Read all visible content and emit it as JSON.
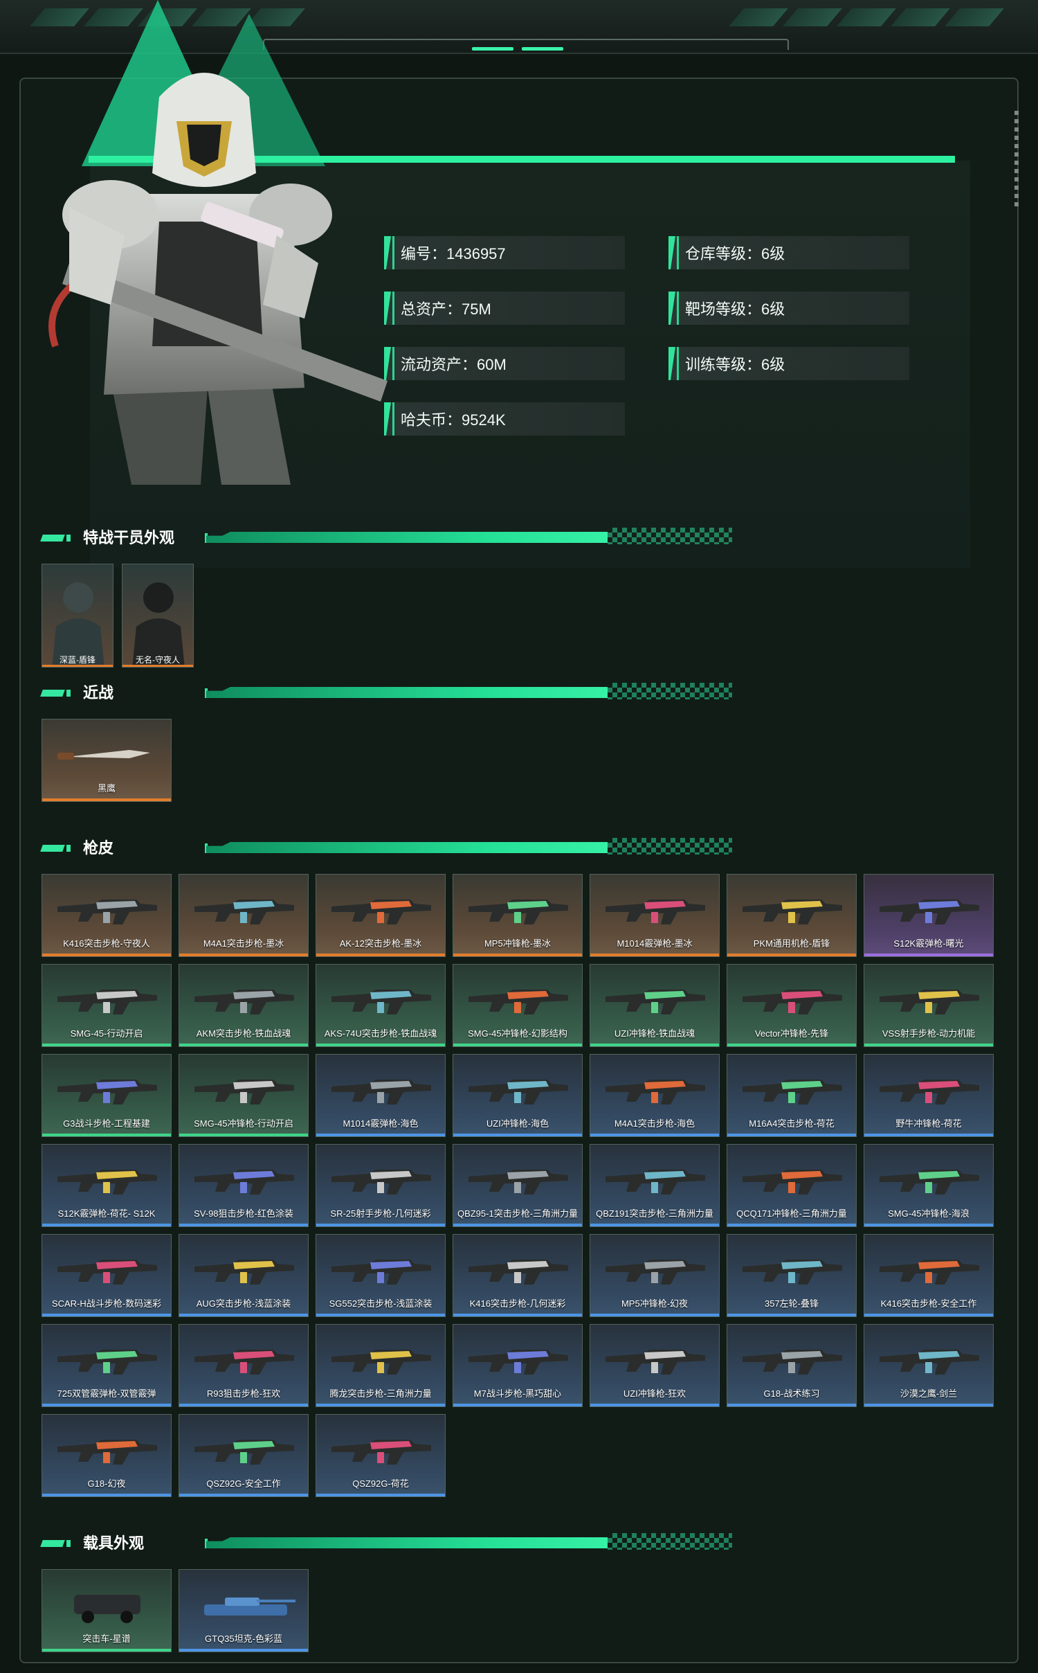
{
  "profile": {
    "id_label": "编号：1436957",
    "total_assets": "总资产：75M",
    "liquid_assets": "流动资产：60M",
    "havoc_coin": "哈夫币：9524K",
    "warehouse_level": "仓库等级：6级",
    "range_level": "靶场等级：6级",
    "training_level": "训练等级：6级"
  },
  "sections": {
    "operators": "特战干员外观",
    "melee": "近战",
    "skins": "枪皮",
    "vehicles": "载具外观"
  },
  "operators": [
    "深蓝-盾锋",
    "无名-守夜人"
  ],
  "melee": [
    "黑鹰"
  ],
  "skins": [
    {
      "label": "K416突击步枪-守夜人",
      "rarity": "orange"
    },
    {
      "label": "M4A1突击步枪-墨冰",
      "rarity": "orange"
    },
    {
      "label": "AK-12突击步枪-墨冰",
      "rarity": "orange"
    },
    {
      "label": "MP5冲锋枪-墨冰",
      "rarity": "orange"
    },
    {
      "label": "M1014霰弹枪-墨冰",
      "rarity": "orange"
    },
    {
      "label": "PKM通用机枪-盾锋",
      "rarity": "orange"
    },
    {
      "label": "S12K霰弹枪-曙光",
      "rarity": "purple"
    },
    {
      "label": "SMG-45-行动开启",
      "rarity": "green"
    },
    {
      "label": "AKM突击步枪-铁血战魂",
      "rarity": "green"
    },
    {
      "label": "AKS-74U突击步枪-铁血战魂",
      "rarity": "green"
    },
    {
      "label": "SMG-45冲锋枪-幻影结构",
      "rarity": "green"
    },
    {
      "label": "UZI冲锋枪-铁血战魂",
      "rarity": "green"
    },
    {
      "label": "Vector冲锋枪-先锋",
      "rarity": "green"
    },
    {
      "label": "VSS射手步枪-动力机能",
      "rarity": "green"
    },
    {
      "label": "G3战斗步枪-工程基建",
      "rarity": "green"
    },
    {
      "label": "SMG-45冲锋枪-行动开启",
      "rarity": "green"
    },
    {
      "label": "M1014霰弹枪-海色",
      "rarity": "blue"
    },
    {
      "label": "UZI冲锋枪-海色",
      "rarity": "blue"
    },
    {
      "label": "M4A1突击步枪-海色",
      "rarity": "blue"
    },
    {
      "label": "M16A4突击步枪-荷花",
      "rarity": "blue"
    },
    {
      "label": "野牛冲锋枪-荷花",
      "rarity": "blue"
    },
    {
      "label": "S12K霰弹枪-荷花- S12K",
      "rarity": "blue"
    },
    {
      "label": "SV-98狙击步枪-红色涂装",
      "rarity": "blue"
    },
    {
      "label": "SR-25射手步枪-几何迷彩",
      "rarity": "blue"
    },
    {
      "label": "QBZ95-1突击步枪-三角洲力量",
      "rarity": "blue"
    },
    {
      "label": "QBZ191突击步枪-三角洲力量",
      "rarity": "blue"
    },
    {
      "label": "QCQ171冲锋枪-三角洲力量",
      "rarity": "blue"
    },
    {
      "label": "SMG-45冲锋枪-海浪",
      "rarity": "blue"
    },
    {
      "label": "SCAR-H战斗步枪-数码迷彩",
      "rarity": "blue"
    },
    {
      "label": "AUG突击步枪-浅蓝涂装",
      "rarity": "blue"
    },
    {
      "label": "SG552突击步枪-浅蓝涂装",
      "rarity": "blue"
    },
    {
      "label": "K416突击步枪-几何迷彩",
      "rarity": "blue"
    },
    {
      "label": "MP5冲锋枪-幻夜",
      "rarity": "blue"
    },
    {
      "label": "357左轮-叠锋",
      "rarity": "blue"
    },
    {
      "label": "K416突击步枪-安全工作",
      "rarity": "blue"
    },
    {
      "label": "725双管霰弹枪-双管霰弹",
      "rarity": "blue"
    },
    {
      "label": "R93狙击步枪-狂欢",
      "rarity": "blue"
    },
    {
      "label": "腾龙突击步枪-三角洲力量",
      "rarity": "blue"
    },
    {
      "label": "M7战斗步枪-黑巧甜心",
      "rarity": "blue"
    },
    {
      "label": "UZI冲锋枪-狂欢",
      "rarity": "blue"
    },
    {
      "label": "G18-战术练习",
      "rarity": "blue"
    },
    {
      "label": "沙漠之鹰-剑兰",
      "rarity": "blue"
    },
    {
      "label": "G18-幻夜",
      "rarity": "blue"
    },
    {
      "label": "QSZ92G-安全工作",
      "rarity": "blue"
    },
    {
      "label": "QSZ92G-荷花",
      "rarity": "blue"
    }
  ],
  "vehicles": [
    {
      "label": "突击车-星谱",
      "rarity": "green"
    },
    {
      "label": "GTQ35坦克-色彩蓝",
      "rarity": "blue"
    }
  ],
  "colors": {
    "accent": "#2df0a0",
    "orange": "#e27d2c",
    "purple": "#9b6fe0",
    "green": "#3fd489",
    "blue": "#4d95e6"
  }
}
